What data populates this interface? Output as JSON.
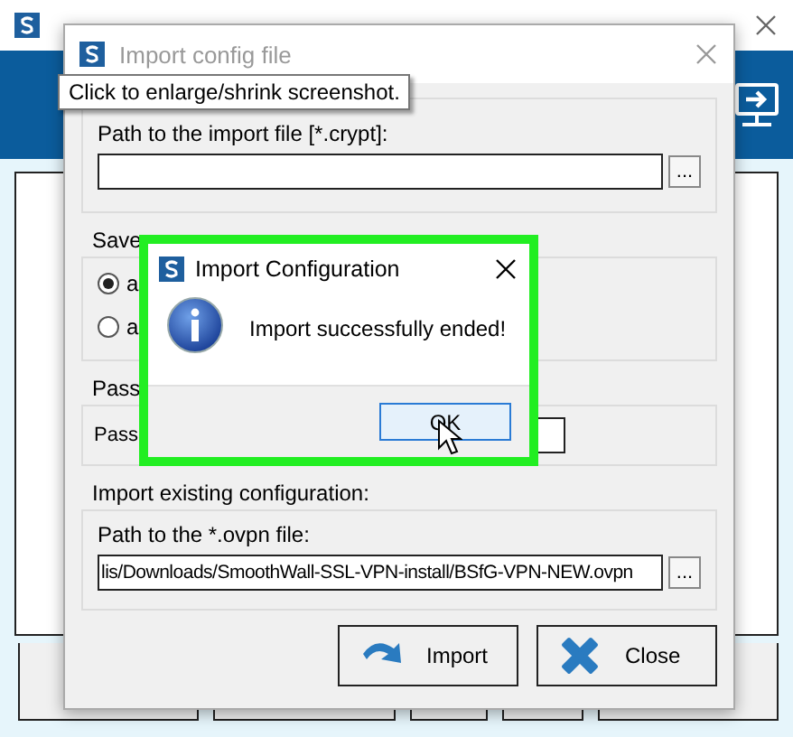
{
  "tooltip": {
    "text": "Click to enlarge/shrink screenshot."
  },
  "import_dialog": {
    "title": "Import config file",
    "active": false,
    "import_file": {
      "label": "Path to the import file [*.crypt]:",
      "browse_button": "..."
    },
    "save_group": {
      "label": "Save",
      "options": [
        {
          "label": "a",
          "selected": true
        },
        {
          "label": "a",
          "selected": false
        }
      ]
    },
    "password_group": {
      "label": "Pass",
      "field_label": "Pass"
    },
    "existing_config": {
      "label": "Import existing configuration:",
      "field_label": "Path to the *.ovpn file:",
      "value": "lis/Downloads/SmoothWall-SSL-VPN-install/BSfG-VPN-NEW.ovpn",
      "browse_button": "..."
    },
    "buttons": [
      {
        "label": "Import",
        "kind": "import"
      },
      {
        "label": "Close",
        "kind": "close"
      }
    ]
  },
  "message_box": {
    "title": "Import Configuration",
    "message": "Import successfully ended!",
    "button": "OK",
    "highlighted": true
  }
}
